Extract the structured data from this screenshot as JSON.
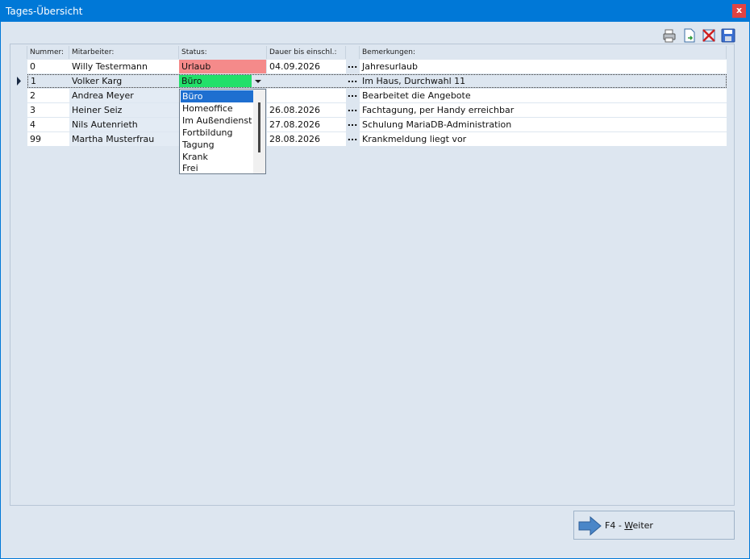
{
  "window": {
    "title": "Tages-Übersicht",
    "close_label": "x"
  },
  "toolbar": {
    "icons": [
      "printer-icon",
      "export-icon",
      "delete-icon",
      "save-icon"
    ]
  },
  "columns": {
    "nummer": "Nummer:",
    "mitarbeiter": "Mitarbeiter:",
    "status": "Status:",
    "dauer": "Dauer bis einschl.:",
    "bemerkungen": "Bemerkungen:"
  },
  "rows": [
    {
      "nummer": "0",
      "mitarbeiter": "Willy Testermann",
      "status": "Urlaub",
      "dauer": "04.09.2026",
      "more": "...",
      "bemerkungen": "Jahresurlaub"
    },
    {
      "nummer": "1",
      "mitarbeiter": "Volker Karg",
      "status": "Büro",
      "dauer": "",
      "more": "...",
      "bemerkungen": "Im Haus, Durchwahl 11"
    },
    {
      "nummer": "2",
      "mitarbeiter": "Andrea Meyer",
      "status": "",
      "dauer": "",
      "more": "...",
      "bemerkungen": "Bearbeitet die Angebote"
    },
    {
      "nummer": "3",
      "mitarbeiter": "Heiner Seiz",
      "status": "",
      "dauer": "26.08.2026",
      "more": "...",
      "bemerkungen": "Fachtagung, per Handy erreichbar"
    },
    {
      "nummer": "4",
      "mitarbeiter": "Nils Autenrieth",
      "status": "",
      "dauer": "27.08.2026",
      "more": "...",
      "bemerkungen": "Schulung MariaDB-Administration"
    },
    {
      "nummer": "99",
      "mitarbeiter": "Martha Musterfrau",
      "status": "",
      "dauer": "28.08.2026",
      "more": "...",
      "bemerkungen": "Krankmeldung liegt vor"
    }
  ],
  "status_dropdown": {
    "selected": "Büro",
    "options": [
      "Büro",
      "Homeoffice",
      "Im Außendienst",
      "Fortbildung",
      "Tagung",
      "Krank",
      "Frei"
    ]
  },
  "colors": {
    "urlaub": "#f58a8a",
    "buero": "#22e06a",
    "selected_option": "#1e6fd0"
  },
  "buttons": {
    "weiter_prefix": "F4 - ",
    "weiter_key": "W",
    "weiter_rest": "eiter"
  }
}
